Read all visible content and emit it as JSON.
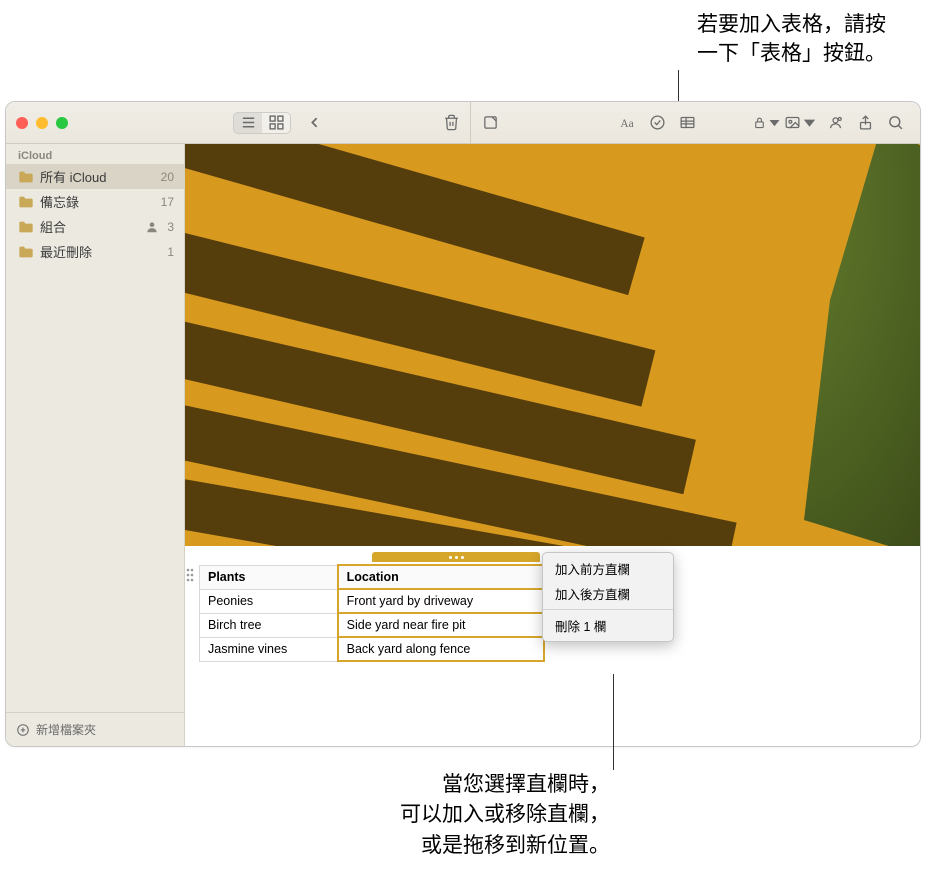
{
  "callouts": {
    "top_line1": "若要加入表格，請按",
    "top_line2": "一下「表格」按鈕。",
    "bottom_line1": "當您選擇直欄時，",
    "bottom_line2": "可以加入或移除直欄，",
    "bottom_line3": "或是拖移到新位置。"
  },
  "sidebar": {
    "header": "iCloud",
    "items": [
      {
        "label": "所有 iCloud",
        "count": "20",
        "selected": true
      },
      {
        "label": "備忘錄",
        "count": "17"
      },
      {
        "label": "組合",
        "count": "3",
        "shared": true
      },
      {
        "label": "最近刪除",
        "count": "1"
      }
    ],
    "new_folder": "新增檔案夾"
  },
  "table": {
    "headers": [
      "Plants",
      "Location"
    ],
    "rows": [
      [
        "Peonies",
        "Front yard by driveway"
      ],
      [
        "Birch tree",
        "Side yard near fire pit"
      ],
      [
        "Jasmine vines",
        "Back yard along fence"
      ]
    ]
  },
  "context_menu": {
    "items": [
      "加入前方直欄",
      "加入後方直欄"
    ],
    "delete": "刪除 1 欄"
  },
  "colors": {
    "accent": "#d6a62b",
    "sidebar_bg": "#ece9e1",
    "selection": "#d9d4c5"
  }
}
